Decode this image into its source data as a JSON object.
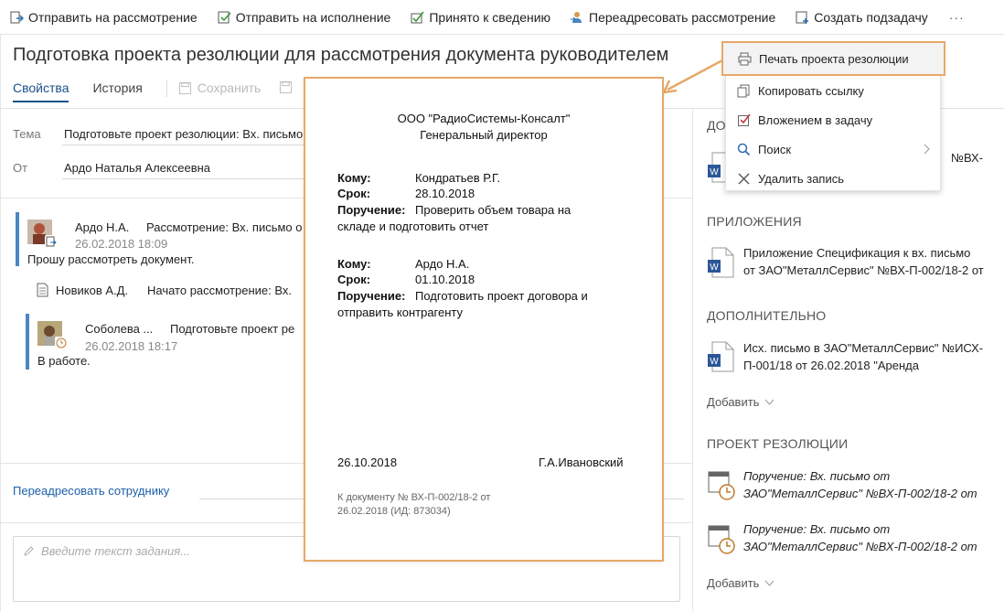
{
  "toolbar": {
    "items": [
      {
        "label": "Отправить на рассмотрение",
        "icon": "send-review-icon"
      },
      {
        "label": "Отправить на исполнение",
        "icon": "send-execute-icon"
      },
      {
        "label": "Принято к сведению",
        "icon": "accepted-icon"
      },
      {
        "label": "Переадресовать рассмотрение",
        "icon": "redirect-user-icon"
      },
      {
        "label": "Создать подзадачу",
        "icon": "subtask-icon"
      }
    ],
    "more": "···"
  },
  "title": "Подготовка проекта резолюции для рассмотрения документа руководителем",
  "tabs": {
    "properties": "Свойства",
    "history": "История",
    "save": "Сохранить"
  },
  "fields": {
    "topic_label": "Тема",
    "topic_value": "Подготовьте проект резолюции: Вх. письмо",
    "from_label": "От",
    "from_value": "Ардо Наталья Алексеевна"
  },
  "thread": [
    {
      "name": "Ардо Н.А.",
      "action": "Рассмотрение: Вх. письмо о",
      "date": "26.02.2018 18:09",
      "text": "Прошу рассмотреть документ."
    },
    {
      "name": "Новиков А.Д.",
      "action": "Начато рассмотрение: Вх."
    },
    {
      "name": "Соболева ...",
      "action": "Подготовьте проект ре",
      "date": "26.02.2018 18:17",
      "text": "В работе."
    }
  ],
  "redirect_link": "Переадресовать сотруднику",
  "task_input": {
    "placeholder": "Введите текст задания..."
  },
  "right": {
    "section_doc_partial": "ДО",
    "doc_partial_text": "№ВХ-",
    "attachments_head": "ПРИЛОЖЕНИЯ",
    "attachment_line1": "Приложение Спецификация к вх. письмо",
    "attachment_line2": "от ЗАО\"МеталлСервис\" №ВХ-П-002/18-2 от",
    "additional_head": "ДОПОЛНИТЕЛЬНО",
    "additional_line1": "Исх. письмо в ЗАО\"МеталлСервис\" №ИСХ-",
    "additional_line2": "П-001/18 от 26.02.2018 \"Аренда",
    "add_label_1": "Добавить",
    "resolution_head": "ПРОЕКТ РЕЗОЛЮЦИИ",
    "res1_line1": "Поручение: Вх. письмо от",
    "res1_line2": "ЗАО\"МеталлСервис\" №ВХ-П-002/18-2 от",
    "res2_line1": "Поручение: Вх. письмо от",
    "res2_line2": "ЗАО\"МеталлСервис\" №ВХ-П-002/18-2 от",
    "add_label_2": "Добавить"
  },
  "menu": {
    "print": "Печать проекта резолюции",
    "copy_link": "Копировать ссылку",
    "attach_to_task": "Вложением в задачу",
    "search": "Поиск",
    "delete": "Удалить запись"
  },
  "preview": {
    "org": "ООО \"РадиоСистемы-Консалт\"",
    "position": "Генеральный директор",
    "to_label": "Кому:",
    "due_label": "Срок:",
    "task_label": "Поручение:",
    "block1": {
      "to": "Кондратьев Р.Г.",
      "due": "28.10.2018",
      "task1": "Проверить объем товара на",
      "task2": "складе и подготовить отчет"
    },
    "block2": {
      "to": "Ардо Н.А.",
      "due": "01.10.2018",
      "task1": "Подготовить проект договора и",
      "task2": "отправить контрагенту"
    },
    "date": "26.10.2018",
    "signer": "Г.А.Ивановский",
    "footer1": "К документу № ВХ-П-002/18-2 от",
    "footer2": "26.02.2018 (ИД: 873034)"
  },
  "colors": {
    "accent": "#1a4f8a",
    "highlight": "#e8a868",
    "thread_bar": "#4a86c5"
  }
}
